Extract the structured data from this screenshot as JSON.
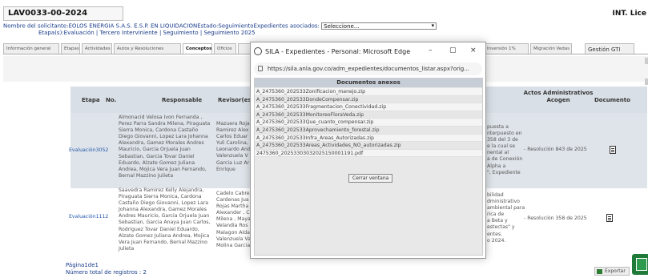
{
  "header": {
    "file_number": "LAV0033-00-2024",
    "right_label": "INT. Lice",
    "requester_label": "Nombre del solicitante:",
    "requester_value": "EOLOS ENERGIA S.A.S. E.S.P. EN LIQUIDACION",
    "estado_label": "Estado:",
    "estado_value": "Seguimiento",
    "expedientes_label": "Expedientes asociados:",
    "expedientes_select": "Seleccione...",
    "etapas_label": "Etapa(s):",
    "etapas_value": "Evaluación | Tercero Interviniente | Seguimiento | Seguimiento 2025"
  },
  "tabs": [
    "Información general",
    "Etapas",
    "Actividades",
    "Autos y Resoluciones",
    "Conceptos",
    "Oficios",
    "",
    "",
    "",
    "",
    "",
    "Inversión 1%",
    "Migración Vedas",
    "Gestión GTI"
  ],
  "table": {
    "headers": {
      "etapa": "Etapa",
      "no": "No.",
      "responsable": "Responsable",
      "revisor": "Revisor(es",
      "actos": "Actos Administrativos Acogen",
      "documento": "Documento"
    },
    "rows": [
      {
        "etapa": "Evaluación",
        "no": "3052",
        "responsable": [
          "Almonacid Velosa Ivon Fernanda ,",
          "Perez Parra Sandra Milena, Piraguata",
          "Sierra Monica, Cardona Castaño",
          "Diego Giovanni, Lopez Lara Johanna",
          "Alexandra, Gamez Morales Andres",
          "Mauricio, Garcia Orjuela Juan",
          "Sebastian, Garcia Tovar Daniel",
          "Eduardo, Alzate Gomez Juliana",
          "Andrea, Mojica Vera Juan Fernando,",
          "Bernal Mazzino Julieta"
        ],
        "revisor": [
          "Mazuera Roja",
          "Ramirez Alex",
          "Carlos Eduar",
          "Yuli Carolina,",
          "Leonardo And",
          "Valenzuela V",
          "Garcia Luz Ar",
          "Enrique"
        ],
        "concepto": [
          "puesta a",
          "nterpuesto en",
          "358 del 3 de",
          "e la cual se",
          "nental al",
          "a de Conexión",
          "Alpha a",
          "\", Expediente"
        ],
        "acto": "- Resolución 843 de 2025"
      },
      {
        "etapa": "Evaluación",
        "no": "1112",
        "responsable": [
          "Saavedra Ramirez Kelly Alejandra,",
          "Piraguata Sierra Monica, Cardona",
          "Castaño Diego Giovanni, Lopez Lara",
          "Johanna Alexandra, Gamez Morales",
          "Andres Mauricio, Garcia Orjuela Juan",
          "Sebastian, Garcia Anaya Juan Carlos,",
          "Rodriguez Tovar Daniel Eduardo,",
          "Alzate Gomez Juliana Andrea, Mojica",
          "Vera Juan Fernando, Bernal Mazzino",
          "Julieta"
        ],
        "revisor": [
          "Cadelo Cabre",
          "Cardenas Jua",
          "Rojas Martha",
          "Alexander , C",
          "Milena , Maya",
          "Velandia Ros",
          "Malagon Alda",
          "Valenzuela Va",
          "Molina Garcia"
        ],
        "concepto": [
          "bilidad",
          "dministrativo",
          "ambiental para",
          "rica de",
          "a Beta y",
          "estectas\" y",
          "entes.",
          "o 2024."
        ],
        "acto": "- Resolución 358 de 2025"
      }
    ]
  },
  "footer": {
    "page": "Página1de1",
    "total": "Número total de registros : 2",
    "export": "Exportar"
  },
  "popup": {
    "title": "SILA - Expedientes - Personal: Microsoft Edge",
    "url": "https://sila.anla.gov.co/adm_expedientes/documentos_listar.aspx?orig...",
    "heading": "Documentos anexos",
    "items": [
      "A_2475360_202533Zonificacion_manejo.zip",
      "A_2475360_202533DondeCompensar.zip",
      "A_2475360_202533Fragmentacion_Conectividad.zip",
      "A_2475360_202533MonitoreoFloraVeda.zip",
      "A_2475360_202533Que_cuanto_compensar.zip",
      "A_2475360_202533Aprovechamiento_forestal.zip",
      "A_2475360_202533Infra_Areas_Autorizadas.zip",
      "A_2475360_202533Areas_Actividades_NO_autorizadas.zip",
      "2475360_20253303032025150001191.pdf"
    ],
    "close_button": "Cerrar ventana"
  },
  "colors": {
    "link": "#1a3c8a",
    "table_header": "#d9dfe6",
    "excel_green": "#1f7a3a"
  }
}
